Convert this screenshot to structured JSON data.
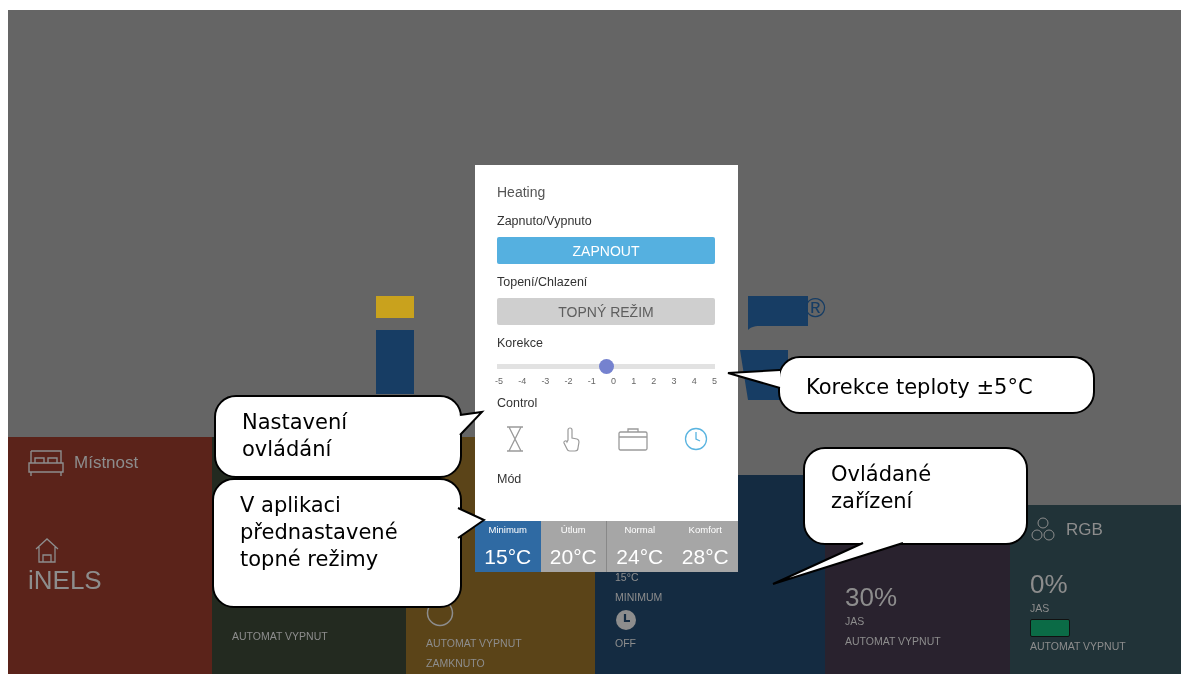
{
  "logo": {
    "mark": "®"
  },
  "dialog": {
    "title": "Heating",
    "power_label": "Zapnuto/Vypnuto",
    "power_button": "ZAPNOUT",
    "mode_label": "Topení/Chlazení",
    "mode_button": "TOPNÝ REŽIM",
    "correction_label": "Korekce",
    "correction": {
      "level": 0.5,
      "ticks": [
        "-5",
        "-4",
        "-3",
        "-2",
        "-1",
        "0",
        "1",
        "2",
        "3",
        "4",
        "5"
      ]
    },
    "control_label": "Control",
    "controls": [
      {
        "kind": "timer",
        "selected": false
      },
      {
        "kind": "manual",
        "selected": false
      },
      {
        "kind": "case",
        "selected": false
      },
      {
        "kind": "clock",
        "selected": true
      }
    ],
    "preset_label": "Mód",
    "presets": [
      {
        "name": "Minimum",
        "temperature": "15°C",
        "selected": true
      },
      {
        "name": "Útlum",
        "temperature": "20°C",
        "selected": false
      },
      {
        "name": "Normal",
        "temperature": "24°C",
        "selected": false
      },
      {
        "name": "Komfort",
        "temperature": "28°C",
        "selected": false
      }
    ]
  },
  "tiles": [
    {
      "kind": "room",
      "title": "Místnost",
      "name": "iNELS"
    },
    {
      "kind": "switch",
      "lines": [
        "AUTOMAT VYPNUT"
      ]
    },
    {
      "kind": "lock",
      "lines": [
        "AUTOMAT VYPNUT",
        "ZAMKNUTO"
      ]
    },
    {
      "kind": "thermostat",
      "temperature": "15°C",
      "mode": "MINIMUM",
      "state": "OFF"
    },
    {
      "kind": "dimmer",
      "value": "30%",
      "label": "JAS",
      "lines": [
        "AUTOMAT VYPNUT"
      ]
    },
    {
      "kind": "rgb",
      "title": "RGB",
      "value": "0%",
      "label": "JAS",
      "color": "#0b6b46",
      "lines": [
        "AUTOMAT VYPNUT"
      ]
    }
  ],
  "callouts": [
    {
      "text": "Nastavení ovládání"
    },
    {
      "text": "V aplikaci přednastavené topné režimy"
    },
    {
      "text": "Korekce teploty ±5°C"
    },
    {
      "text": "Ovládané zařízení"
    }
  ]
}
